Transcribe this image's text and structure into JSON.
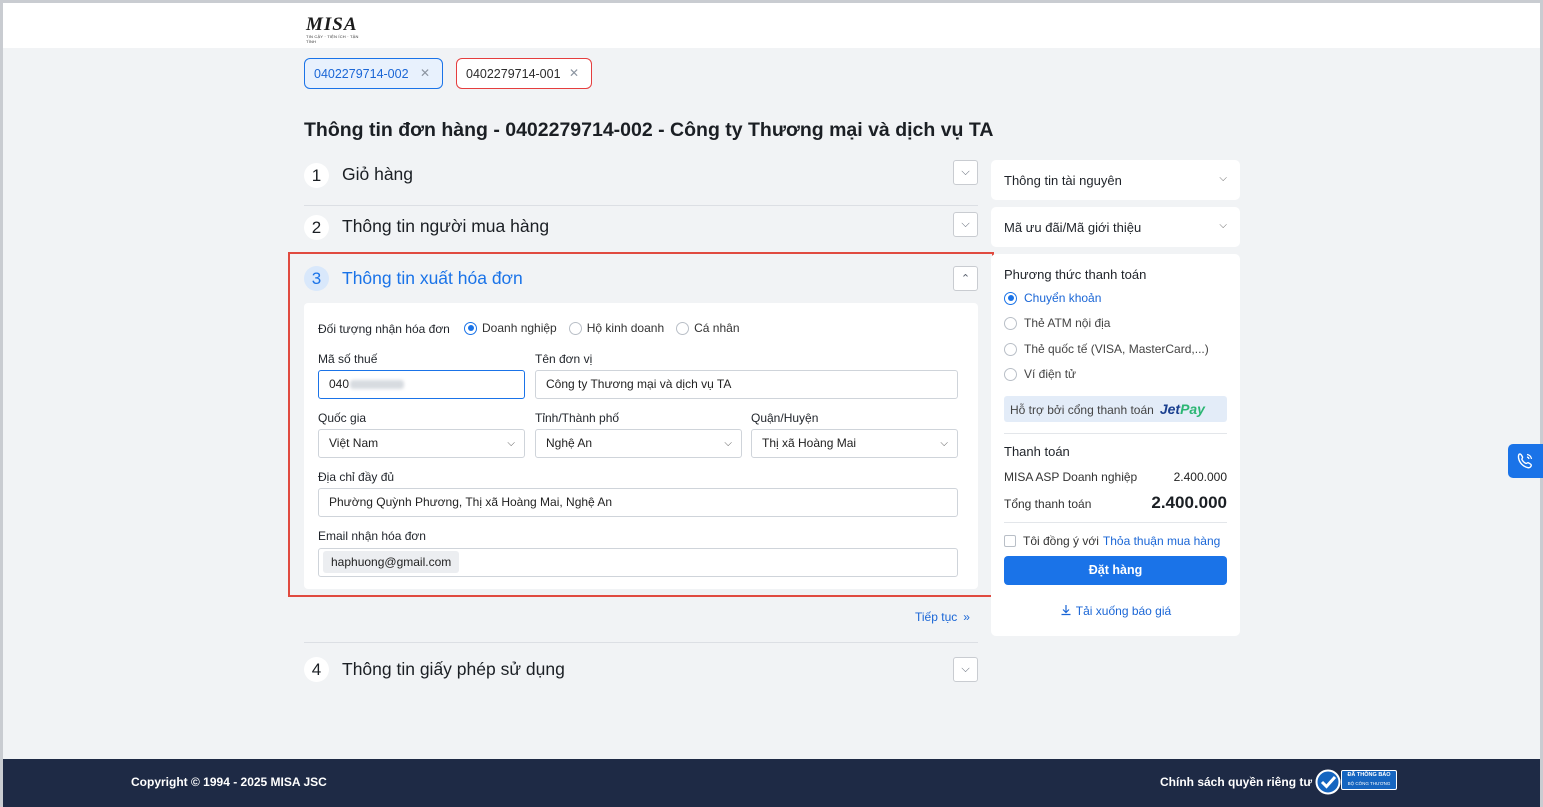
{
  "header": {
    "logo_text": "MISA",
    "logo_tagline": "TIN CẬY · TIỆN ÍCH · TẬN TÌNH"
  },
  "tabs": [
    {
      "label": "0402279714-002",
      "active": true
    },
    {
      "label": "0402279714-001",
      "active": false
    }
  ],
  "page_title": "Thông tin đơn hàng - 0402279714-002 - Công ty Thương mại và dịch vụ TA",
  "sections": [
    {
      "num": "1",
      "title": "Giỏ hàng"
    },
    {
      "num": "2",
      "title": "Thông tin người mua hàng"
    },
    {
      "num": "3",
      "title": "Thông tin xuất hóa đơn"
    },
    {
      "num": "4",
      "title": "Thông tin giấy phép sử dụng"
    }
  ],
  "invoice_form": {
    "recipient_label": "Đối tượng nhận hóa đơn",
    "recipient_options": [
      "Doanh nghiệp",
      "Hộ kinh doanh",
      "Cá nhân"
    ],
    "recipient_selected": "Doanh nghiệp",
    "tax_code_label": "Mã số thuế",
    "tax_code_value": "040",
    "unit_name_label": "Tên đơn vị",
    "unit_name_value": "Công ty Thương mại và dịch vụ TA",
    "country_label": "Quốc gia",
    "country_value": "Việt Nam",
    "province_label": "Tỉnh/Thành phố",
    "province_value": "Nghệ An",
    "district_label": "Quận/Huyện",
    "district_value": "Thị xã Hoàng Mai",
    "address_label": "Địa chỉ đầy đủ",
    "address_value": "Phường Quỳnh Phương, Thị xã Hoàng Mai, Nghệ An",
    "email_label": "Email nhận hóa đơn",
    "email_value": "haphuong@gmail.com"
  },
  "continue_label": "Tiếp tục",
  "sidebar": {
    "resource_info": "Thông tin tài nguyên",
    "promo_code": "Mã ưu đãi/Mã giới thiệu",
    "payment_method_title": "Phương thức thanh toán",
    "payment_methods": [
      "Chuyển khoản",
      "Thẻ ATM nội địa",
      "Thẻ quốc tế (VISA, MasterCard,...)",
      "Ví điện tử"
    ],
    "payment_selected": "Chuyển khoản",
    "gateway_text": "Hỗ trợ bởi cổng thanh toán",
    "gateway_brand_a": "Jet",
    "gateway_brand_b": "Pay",
    "payment_title": "Thanh toán",
    "product_name": "MISA ASP Doanh nghiệp",
    "product_price": "2.400.000",
    "total_label": "Tổng thanh toán",
    "total_value": "2.400.000",
    "agree_text": "Tôi đồng ý với",
    "agree_link": "Thỏa thuận mua hàng",
    "order_button": "Đặt hàng",
    "download_quote": "Tải xuống báo giá"
  },
  "footer": {
    "copyright": "Copyright © 1994 - 2025 MISA JSC",
    "privacy": "Chính sách quyền riêng tư",
    "badge_line1": "ĐÃ THÔNG BÁO",
    "badge_line2": "BỘ CÔNG THƯƠNG"
  },
  "colors": {
    "primary": "#1a73e8",
    "highlight_border": "#e04a3f",
    "footer_bg": "#1e2a45"
  }
}
